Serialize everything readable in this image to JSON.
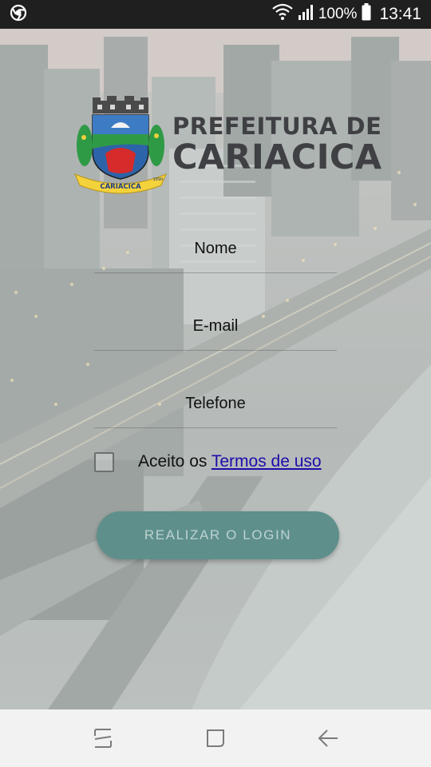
{
  "status_bar": {
    "battery_percent": "100%",
    "time": "13:41",
    "icons": [
      "chrome-icon",
      "wifi-icon",
      "signal-icon",
      "battery-icon"
    ]
  },
  "logo": {
    "line1": "PREFEITURA DE",
    "line2": "CARIACICA",
    "crest_banner": "CARIACICA",
    "crest_year": "1890"
  },
  "form": {
    "name_placeholder": "Nome",
    "email_placeholder": "E-mail",
    "phone_placeholder": "Telefone",
    "terms_prefix": "Aceito os ",
    "terms_link": "Termos de uso",
    "terms_checked": false,
    "login_button": "REALIZAR O LOGIN"
  },
  "nav_bar": {
    "buttons": [
      "recents-icon",
      "home-icon",
      "back-icon"
    ]
  },
  "colors": {
    "button": "#5e8f8b",
    "link": "#1a0dab",
    "logo_text": "#3f4044",
    "status_bar": "#1f1f1f",
    "nav_bar": "#f2f2f2"
  }
}
